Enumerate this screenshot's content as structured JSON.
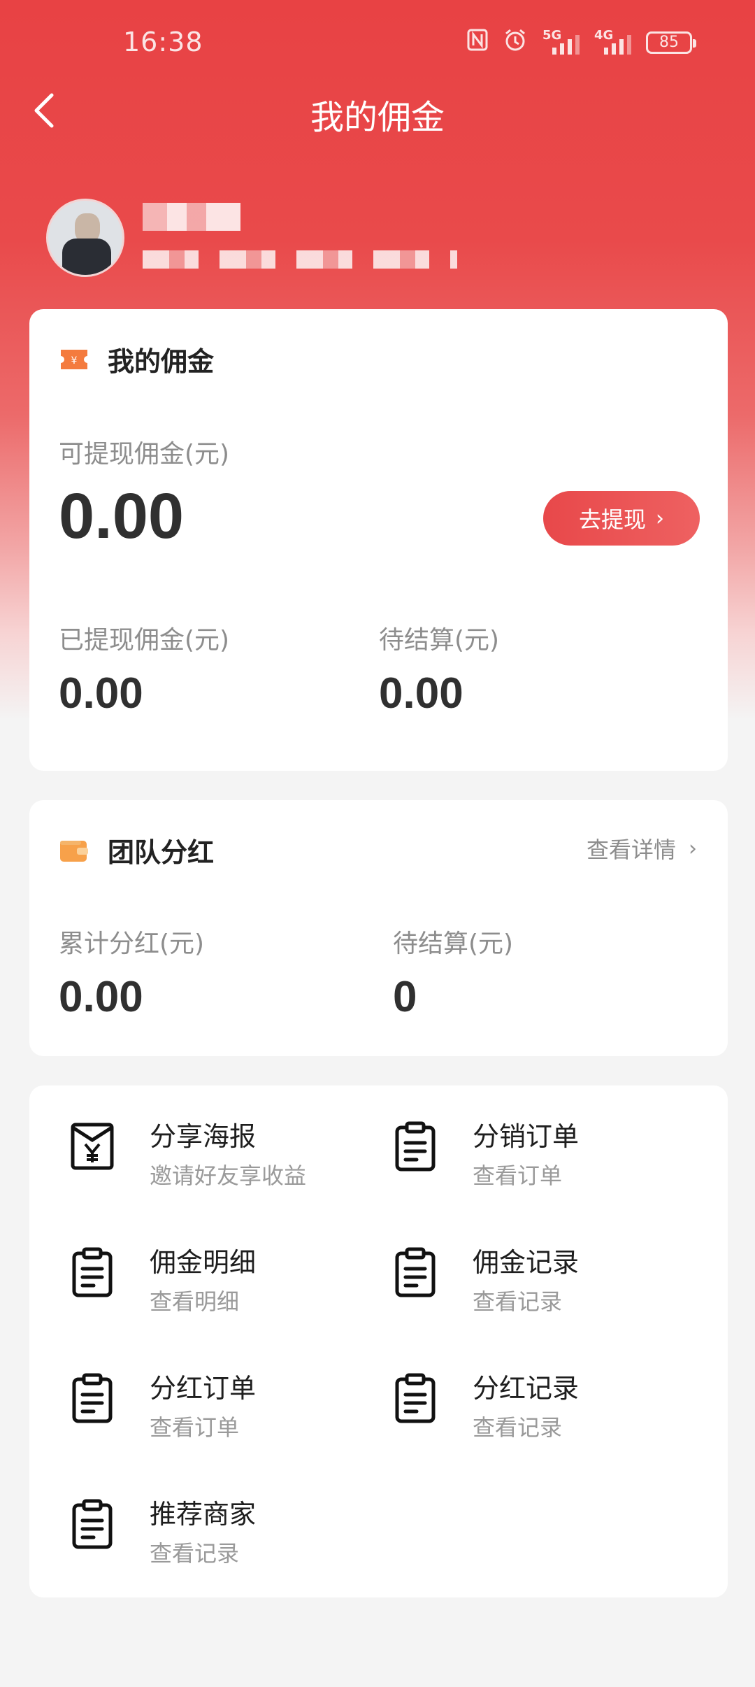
{
  "status_bar": {
    "time": "16:38",
    "icons": [
      "nfc-icon",
      "alarm-icon",
      "signal-5g-icon",
      "signal-4g-icon"
    ],
    "signal_5g": "5G",
    "signal_4g": "4G",
    "battery": "85"
  },
  "nav": {
    "title": "我的佣金",
    "back_icon": "chevron-left-icon"
  },
  "commission": {
    "title": "我的佣金",
    "available_label": "可提现佣金(元)",
    "available_value": "0.00",
    "withdraw_button": "去提现",
    "withdrawn_label": "已提现佣金(元)",
    "withdrawn_value": "0.00",
    "pending_label": "待结算(元)",
    "pending_value": "0.00"
  },
  "team": {
    "title": "团队分红",
    "detail_link": "查看详情",
    "total_label": "累计分红(元)",
    "total_value": "0.00",
    "pending_label": "待结算(元)",
    "pending_value": "0"
  },
  "menu": {
    "items": [
      {
        "title": "分享海报",
        "subtitle": "邀请好友享收益",
        "icon": "envelope-yen-icon"
      },
      {
        "title": "分销订单",
        "subtitle": "查看订单",
        "icon": "clipboard-icon"
      },
      {
        "title": "佣金明细",
        "subtitle": "查看明细",
        "icon": "clipboard-icon"
      },
      {
        "title": "佣金记录",
        "subtitle": "查看记录",
        "icon": "clipboard-icon"
      },
      {
        "title": "分红订单",
        "subtitle": "查看订单",
        "icon": "clipboard-icon"
      },
      {
        "title": "分红记录",
        "subtitle": "查看记录",
        "icon": "clipboard-icon"
      },
      {
        "title": "推荐商家",
        "subtitle": "查看记录",
        "icon": "clipboard-icon"
      }
    ]
  },
  "colors": {
    "header_red": "#e84244",
    "accent_orange": "#f47b3e",
    "text_dark": "#303030",
    "text_gray": "#8d8d8d"
  }
}
